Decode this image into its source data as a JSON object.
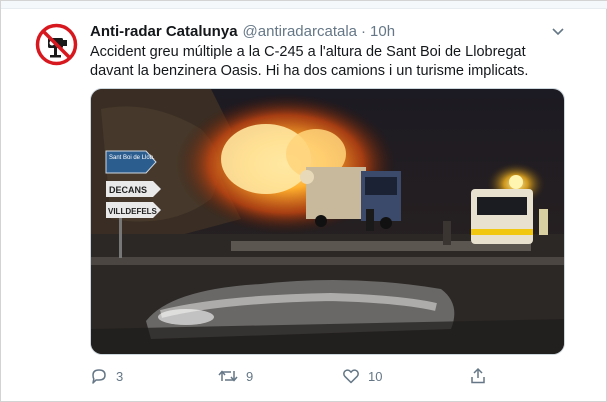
{
  "tweet": {
    "author_name": "Anti-radar Catalunya",
    "author_handle": "@antiradarcatala",
    "separator": "·",
    "time": "10h",
    "text": "Accident greu múltiple a la C-245 a l'altura de Sant Boi de Llobregat davant la benzinera Oasis. Hi ha dos camions i un turisme implicats."
  },
  "media": {
    "signs": [
      "Sant Boi de Llob.",
      "DECANS",
      "VILLDEFELS"
    ]
  },
  "actions": {
    "replies": "3",
    "retweets": "9",
    "likes": "10"
  },
  "icons": {
    "avatar": "no-radar-icon",
    "menu": "chevron-down-icon",
    "reply": "reply-icon",
    "retweet": "retweet-icon",
    "like": "heart-icon",
    "share": "share-icon"
  },
  "colors": {
    "avatar_ring": "#d7191f",
    "text": "#14171a",
    "secondary": "#657786",
    "fire": "#ff8a1a"
  }
}
